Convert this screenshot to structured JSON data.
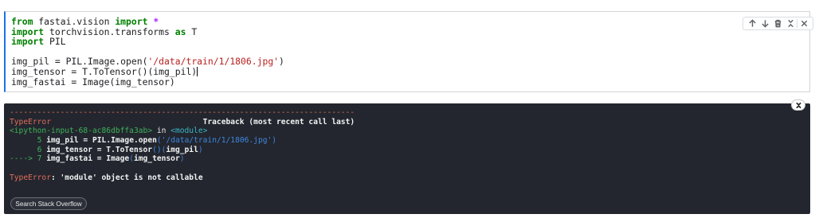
{
  "code_cell": {
    "lines": [
      {
        "tokens": [
          {
            "t": "from",
            "c": "kw"
          },
          {
            "t": " fastai.vision "
          },
          {
            "t": "import",
            "c": "kw"
          },
          {
            "t": " "
          },
          {
            "t": "*",
            "c": "op"
          }
        ]
      },
      {
        "tokens": [
          {
            "t": "import",
            "c": "kw"
          },
          {
            "t": " torchvision.transforms "
          },
          {
            "t": "as",
            "c": "kw"
          },
          {
            "t": " T"
          }
        ]
      },
      {
        "tokens": [
          {
            "t": "import",
            "c": "kw"
          },
          {
            "t": " PIL"
          }
        ]
      },
      {
        "tokens": []
      },
      {
        "tokens": [
          {
            "t": "img_pil = PIL.Image.open("
          },
          {
            "t": "'/data/train/1/1806.jpg'",
            "c": "str"
          },
          {
            "t": ")"
          }
        ]
      },
      {
        "tokens": [
          {
            "t": "img_tensor = T.ToTensor()(img_pil)"
          },
          {
            "cursor": true
          }
        ]
      },
      {
        "tokens": [
          {
            "t": "img_fastai = Image(img_tensor)"
          }
        ]
      }
    ]
  },
  "cell_toolbar": {
    "icons": [
      "arrow-up-icon",
      "arrow-down-icon",
      "delete-icon",
      "collapse-icon",
      "close-icon"
    ]
  },
  "output": {
    "traceback_lines": [
      {
        "tokens": [
          {
            "t": "---------------------------------------------------------------------------",
            "c": "t-red"
          }
        ]
      },
      {
        "tokens": [
          {
            "t": "TypeError",
            "c": "t-red"
          },
          {
            "t": "                                 Traceback (most recent call last)",
            "c": "t-bold"
          }
        ]
      },
      {
        "tokens": [
          {
            "t": "<ipython-input-68-ac86dbffa3ab>",
            "c": "t-green"
          },
          {
            "t": " in "
          },
          {
            "t": "<module>",
            "c": "t-cyan"
          }
        ]
      },
      {
        "tokens": [
          {
            "t": "      5",
            "c": "t-green"
          },
          {
            "t": " img_pil = PIL",
            "c": "t-bold"
          },
          {
            "t": ".",
            "c": "t-bold"
          },
          {
            "t": "Image",
            "c": "t-bold"
          },
          {
            "t": ".",
            "c": "t-bold"
          },
          {
            "t": "open",
            "c": "t-bold"
          },
          {
            "t": "(",
            "c": "t-blue"
          },
          {
            "t": "'/data/train/1/1806.jpg'",
            "c": "t-blue"
          },
          {
            "t": ")",
            "c": "t-blue"
          }
        ]
      },
      {
        "tokens": [
          {
            "t": "      6",
            "c": "t-green"
          },
          {
            "t": " img_tensor = T",
            "c": "t-bold"
          },
          {
            "t": ".",
            "c": "t-bold"
          },
          {
            "t": "ToTensor",
            "c": "t-bold"
          },
          {
            "t": "()",
            "c": "t-blue"
          },
          {
            "t": "(",
            "c": "t-blue"
          },
          {
            "t": "img_pil",
            "c": "t-bold"
          },
          {
            "t": ")",
            "c": "t-blue"
          }
        ]
      },
      {
        "tokens": [
          {
            "t": "----> 7",
            "c": "t-green"
          },
          {
            "t": " img_fastai = Image",
            "c": "t-bold"
          },
          {
            "t": "(",
            "c": "t-blue"
          },
          {
            "t": "img_tensor",
            "c": "t-bold"
          },
          {
            "t": ")",
            "c": "t-blue"
          }
        ]
      },
      {
        "tokens": []
      },
      {
        "tokens": [
          {
            "t": "TypeError",
            "c": "t-red"
          },
          {
            "t": ": 'module' object is not callable",
            "c": "t-bold"
          }
        ]
      }
    ],
    "search_button_label": "Search Stack Overflow"
  },
  "colors": {
    "accent": "#1a73e8",
    "output_background": "#23262e",
    "error_red": "#e06c5a",
    "green": "#3fb25a",
    "cyan": "#39b6c8",
    "blue": "#3e87e0"
  }
}
